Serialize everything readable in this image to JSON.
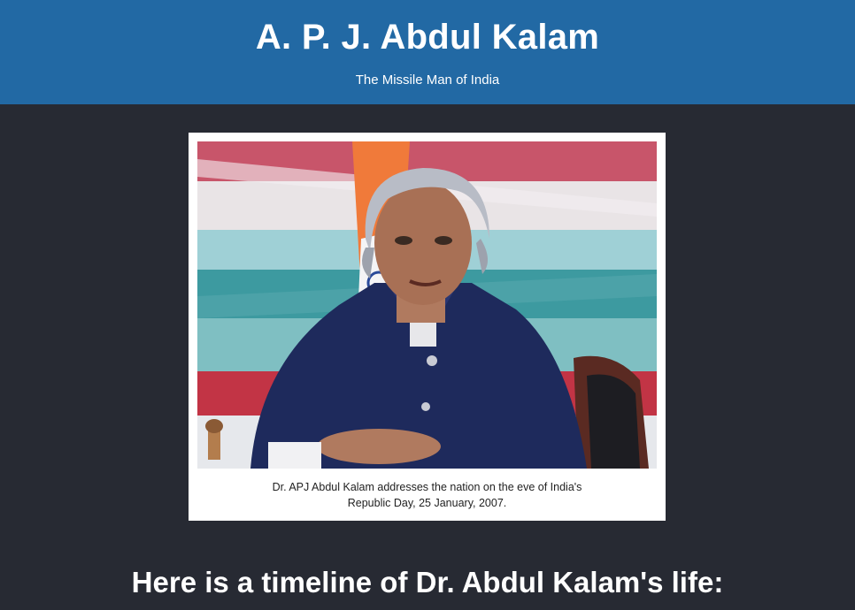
{
  "header": {
    "title": "A. P. J. Abdul Kalam",
    "subtitle": "The Missile Man of India"
  },
  "figure": {
    "caption_line1": "Dr. APJ Abdul Kalam addresses the nation on the eve of India's",
    "caption_line2": "Republic Day, 25 January, 2007."
  },
  "timeline": {
    "heading": "Here is a timeline of Dr. Abdul Kalam's life:"
  },
  "colors": {
    "header_bg": "#2269a4",
    "page_bg": "#272a33",
    "figure_bg": "#ffffff"
  }
}
